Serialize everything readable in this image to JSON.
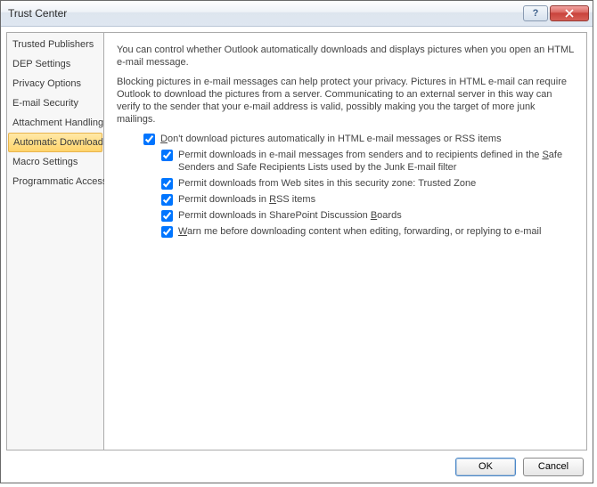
{
  "window": {
    "title": "Trust Center"
  },
  "sidebar": {
    "items": [
      {
        "label": "Trusted Publishers",
        "selected": false
      },
      {
        "label": "DEP Settings",
        "selected": false
      },
      {
        "label": "Privacy Options",
        "selected": false
      },
      {
        "label": "E-mail Security",
        "selected": false
      },
      {
        "label": "Attachment Handling",
        "selected": false
      },
      {
        "label": "Automatic Download",
        "selected": true
      },
      {
        "label": "Macro Settings",
        "selected": false
      },
      {
        "label": "Programmatic Access",
        "selected": false
      }
    ]
  },
  "main": {
    "intro1": "You can control whether Outlook automatically downloads and displays pictures when you open an HTML e-mail message.",
    "intro2": "Blocking pictures in e-mail messages can help protect your privacy. Pictures in HTML e-mail can require Outlook to download the pictures from a server. Communicating to an external server in this way can verify to the sender that your e-mail address is valid, possibly making you the target of more junk mailings.",
    "master_prefix": "D",
    "master_suffix": "on't download pictures automatically in HTML e-mail messages or RSS items",
    "sub": [
      {
        "pre": "Permit downloads in e-mail messages from senders and to recipients defined in the ",
        "u": "S",
        "post": "afe Senders and Safe Recipients Lists used by the Junk E-mail filter"
      },
      {
        "pre": "Permit downloads from Web sites in this security zone: Trusted Zone",
        "u": "",
        "post": ""
      },
      {
        "pre": "Permit downloads in ",
        "u": "R",
        "post": "SS items"
      },
      {
        "pre": "Permit downloads in SharePoint Discussion ",
        "u": "B",
        "post": "oards"
      },
      {
        "pre": "",
        "u": "W",
        "post": "arn me before downloading content when editing, forwarding, or replying to e-mail"
      }
    ]
  },
  "footer": {
    "ok": "OK",
    "cancel": "Cancel"
  }
}
